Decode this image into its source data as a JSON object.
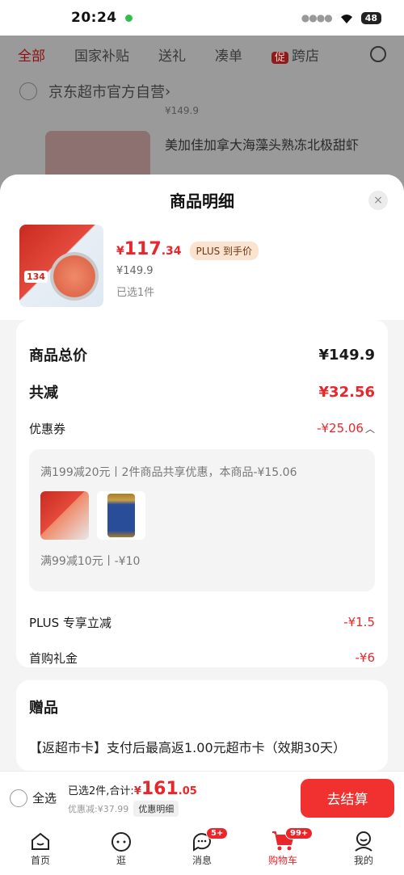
{
  "status": {
    "time": "20:24",
    "battery": "48"
  },
  "background": {
    "tabs": [
      "全部",
      "国家补贴",
      "送礼",
      "凑单",
      "跨店"
    ],
    "promo_badge": "促",
    "store_name": "京东超市官方自营",
    "store_chevron": "›",
    "item_title": "美加佳加拿大海藻头熟冻北极甜虾",
    "item_price_peek": "¥149.9"
  },
  "sheet": {
    "title": "商品明细",
    "close": "×",
    "product": {
      "currency": "¥",
      "price_int": "117",
      "price_dec": ".34",
      "plus_tag": "PLUS 到手价",
      "original_price": "¥149.9",
      "selected": "已选1件",
      "thumb_badge": "134"
    },
    "summary": {
      "total_label": "商品总价",
      "total_value": "¥149.9",
      "reduce_label": "共减",
      "reduce_value": "¥32.56",
      "coupon_label": "优惠券",
      "coupon_value": "-¥25.06",
      "coupon_line1": "满199减20元丨2件商品共享优惠，本商品-¥15.06",
      "coupon_line2": "满99减10元丨-¥10",
      "plus_label": "PLUS 专享立减",
      "plus_value": "-¥1.5",
      "first_label": "首购礼金",
      "first_value": "-¥6"
    },
    "gift": {
      "title": "赠品",
      "text": "【返超市卡】支付后最高返1.00元超市卡（效期30天）"
    }
  },
  "action_bar": {
    "select_all": "全选",
    "total_prefix": "已选2件,合计:",
    "currency": "¥",
    "total_int": "161",
    "total_dec": ".05",
    "discount": "优惠减:¥37.99",
    "detail_chip": "优惠明细",
    "checkout": "去结算"
  },
  "tabbar": {
    "items": [
      {
        "label": "首页",
        "icon": "home-icon"
      },
      {
        "label": "逛",
        "icon": "face-icon"
      },
      {
        "label": "消息",
        "icon": "message-icon",
        "badge": "5+"
      },
      {
        "label": "购物车",
        "icon": "cart-icon",
        "badge": "99+"
      },
      {
        "label": "我的",
        "icon": "user-icon"
      }
    ]
  },
  "colors": {
    "accent": "#e8262b",
    "checkout": "#f0312f"
  }
}
